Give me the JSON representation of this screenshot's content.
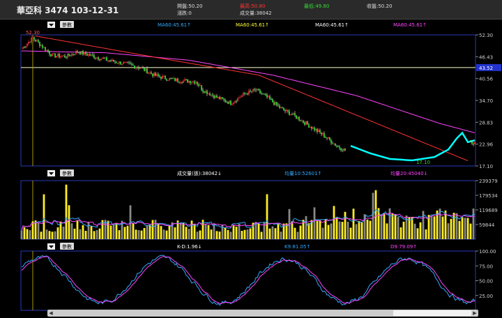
{
  "header": {
    "title": "華亞科 3474 103-12-31",
    "open": "開盤:50.20",
    "change": "漲跌:0",
    "high": "最高:50.80",
    "volume": "成交量:38042",
    "low": "最低:49.80",
    "close": "收盤:50.20",
    "colors": {
      "high": "#ff3333",
      "low": "#33dd33"
    }
  },
  "panels": [
    {
      "id": "price",
      "button": "參數",
      "legend": [
        {
          "text": "MA60:45.61↑",
          "color": "#33aaff"
        },
        {
          "text": "MA60:45.61↑",
          "color": "#ffff33"
        },
        {
          "text": "MA60:45.61↑",
          "color": "#ffffff"
        },
        {
          "text": "MA60:45.61↑",
          "color": "#ff44ff"
        }
      ],
      "y_ticks": [
        "52.30",
        "46.43",
        "40.56",
        "34.70",
        "28.83",
        "22.96",
        "17.10"
      ],
      "highlight": "43.52",
      "marks": [
        "52.30",
        "17.10"
      ]
    },
    {
      "id": "volume",
      "button": "參數",
      "legend": [
        {
          "text": "成交量(張):38042↓",
          "color": "#ffffff"
        },
        {
          "text": "均量10:52601↑",
          "color": "#33aaff"
        },
        {
          "text": "均量20:45040↓",
          "color": "#ff44ff"
        }
      ],
      "y_ticks": [
        "239379",
        "179534",
        "119689",
        "59844"
      ]
    },
    {
      "id": "kd",
      "button": "參數",
      "legend": [
        {
          "text": "K-D:1.96↓",
          "color": "#ffffff"
        },
        {
          "text": "K9:81.05↑",
          "color": "#33aaff"
        },
        {
          "text": "D9:79.09↑",
          "color": "#ff44ff"
        }
      ],
      "y_ticks": [
        "100.00",
        "75.00",
        "50.00",
        "25.00"
      ]
    }
  ],
  "chart_data": [
    {
      "type": "candlestick",
      "y_range": [
        17.1,
        52.3
      ],
      "keypoints": [
        [
          0,
          48.5
        ],
        [
          8,
          51.5
        ],
        [
          14,
          49.5
        ],
        [
          22,
          46.8
        ],
        [
          32,
          46.5
        ],
        [
          40,
          47.8
        ],
        [
          55,
          46.2
        ],
        [
          65,
          45.2
        ],
        [
          75,
          44.5
        ],
        [
          85,
          43.5
        ],
        [
          95,
          41.5
        ],
        [
          105,
          40.5
        ],
        [
          115,
          40.0
        ],
        [
          125,
          39.8
        ],
        [
          130,
          37.5
        ],
        [
          140,
          35.5
        ],
        [
          150,
          34.0
        ],
        [
          160,
          36.5
        ],
        [
          168,
          37.5
        ],
        [
          176,
          35.5
        ],
        [
          186,
          32.5
        ],
        [
          196,
          30.5
        ],
        [
          206,
          28.0
        ],
        [
          216,
          25.5
        ],
        [
          226,
          22.5
        ],
        [
          236,
          20.5
        ],
        [
          246,
          18.5
        ],
        [
          252,
          17.8
        ],
        [
          258,
          17.2
        ],
        [
          268,
          18.5
        ],
        [
          278,
          19.0
        ],
        [
          286,
          18.0
        ],
        [
          292,
          19.5
        ],
        [
          300,
          20.5
        ],
        [
          306,
          21.0
        ],
        [
          314,
          22.0
        ],
        [
          320,
          23.5
        ]
      ],
      "series": [
        {
          "name": "MA60",
          "color": "#ff44ff",
          "values": [
            [
              0,
              48
            ],
            [
              60,
              47.5
            ],
            [
              120,
              45.5
            ],
            [
              180,
              41.5
            ],
            [
              240,
              36
            ],
            [
              300,
              28.5
            ],
            [
              325,
              26
            ]
          ]
        },
        {
          "name": "trend",
          "color": "#ff3333",
          "values": [
            [
              10,
              52
            ],
            [
              100,
              46
            ],
            [
              170,
              41.5
            ],
            [
              320,
              18.5
            ]
          ]
        },
        {
          "name": "bowl",
          "color": "#00ffff",
          "values": [
            [
              236,
              22.5
            ],
            [
              250,
              20.5
            ],
            [
              264,
              19
            ],
            [
              280,
              18.6
            ],
            [
              296,
              19.5
            ],
            [
              306,
              21.5
            ],
            [
              312,
              24.5
            ],
            [
              316,
              26
            ],
            [
              320,
              23.5
            ],
            [
              325,
              24
            ]
          ]
        }
      ]
    },
    {
      "type": "bar",
      "y_range": [
        0,
        239379
      ]
    },
    {
      "type": "line",
      "y_range": [
        0,
        100
      ]
    }
  ]
}
